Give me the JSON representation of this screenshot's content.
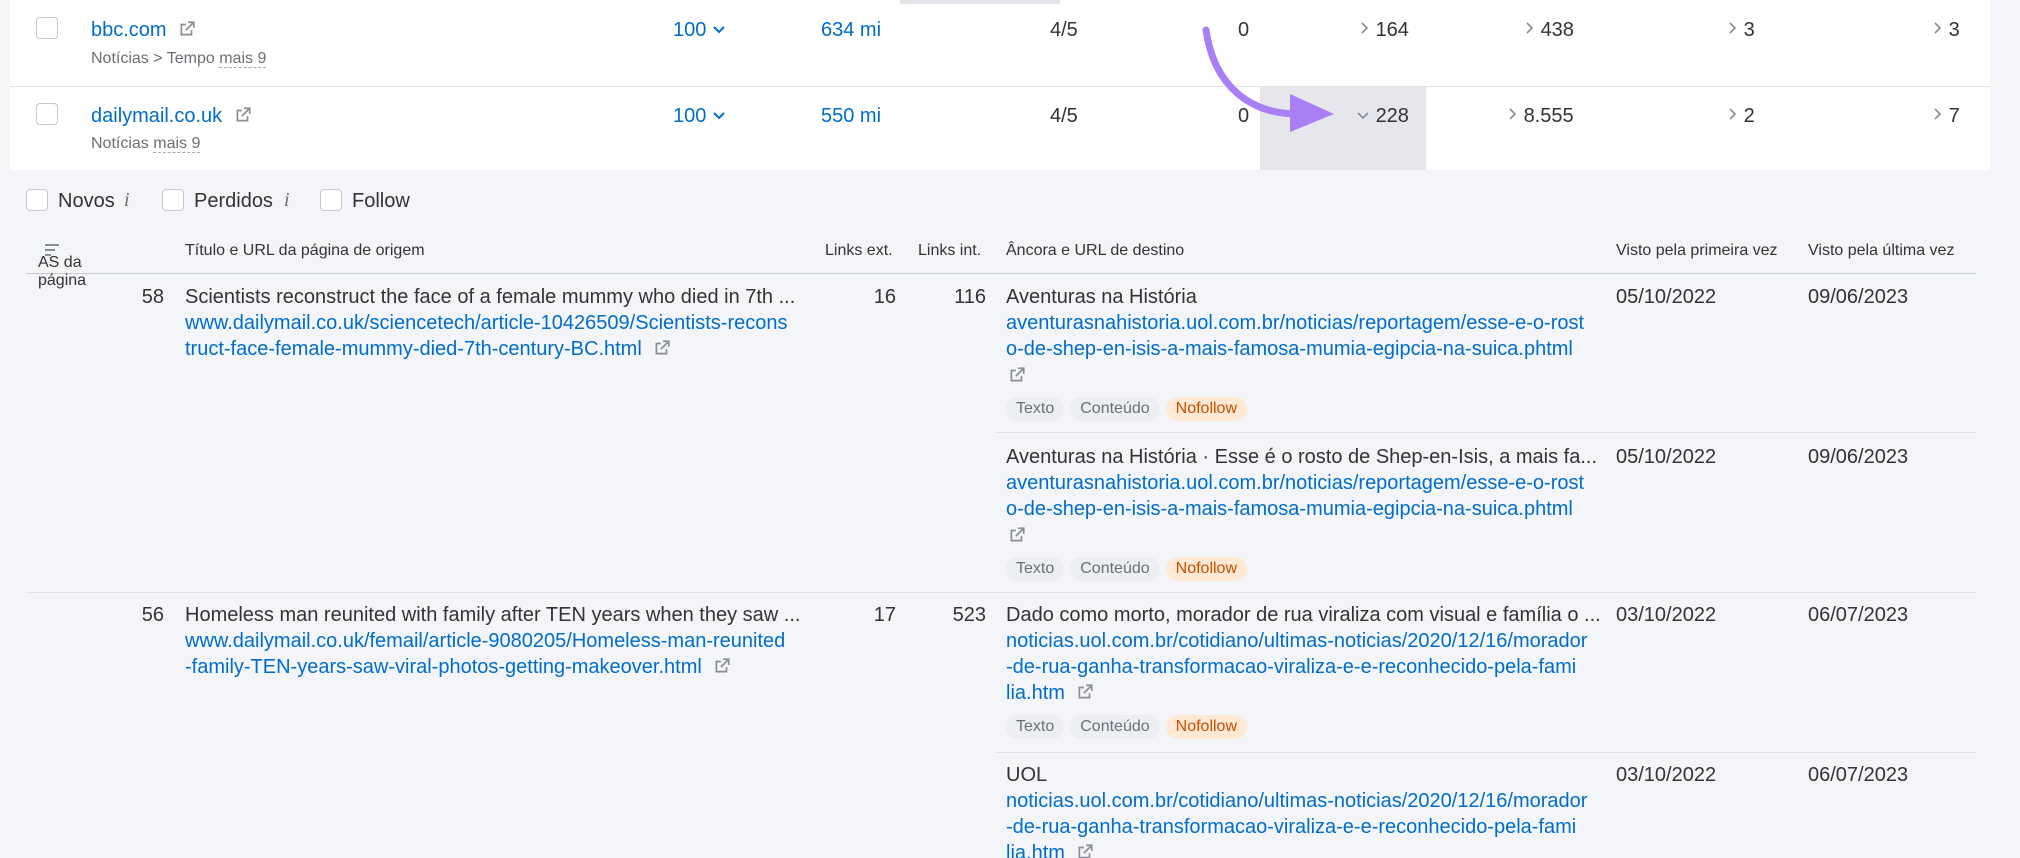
{
  "domains": [
    {
      "domain": "bbc.com",
      "category": "Notícias > Tempo",
      "more": "mais 9",
      "as": "100",
      "traffic": "634 mi",
      "ratio": "4/5",
      "zero": "0",
      "c1": "164",
      "c2": "438",
      "c3": "3",
      "c4": "3"
    },
    {
      "domain": "dailymail.co.uk",
      "category": "Notícias",
      "more": "mais 9",
      "as": "100",
      "traffic": "550 mi",
      "ratio": "4/5",
      "zero": "0",
      "c1": "228",
      "c2": "8.555",
      "c3": "2",
      "c4": "7"
    }
  ],
  "filters": {
    "new": "Novos",
    "lost": "Perdidos",
    "follow": "Follow"
  },
  "columns": {
    "as": "AS da página",
    "source": "Título e URL da página de origem",
    "ext": "Links ext.",
    "int": "Links int.",
    "anchor": "Âncora e URL de destino",
    "first": "Visto pela primeira vez",
    "last": "Visto pela última vez"
  },
  "tags": {
    "text": "Texto",
    "content": "Conteúdo",
    "nofollow": "Nofollow"
  },
  "backlinks": [
    {
      "as": "58",
      "title": "Scientists reconstruct the face of a female mummy who died in 7th ...",
      "url1": "www.dailymail.co.uk/sciencetech/article-10426509/Scientists-recons",
      "url2": "truct-face-female-mummy-died-7th-century-BC.html",
      "ext": "16",
      "int": "116",
      "anchors": [
        {
          "anchor": "Aventuras na História",
          "u1": "aventurasnahistoria.uol.com.br/noticias/reportagem/esse-e-o-rost",
          "u2": "o-de-shep-en-isis-a-mais-famosa-mumia-egipcia-na-suica.phtml",
          "u3": "",
          "first": "05/10/2022",
          "last": "09/06/2023"
        },
        {
          "anchor": "Aventuras na História · Esse é o rosto de Shep-en-Isis, a mais fa...",
          "u1": "aventurasnahistoria.uol.com.br/noticias/reportagem/esse-e-o-rost",
          "u2": "o-de-shep-en-isis-a-mais-famosa-mumia-egipcia-na-suica.phtml",
          "u3": "",
          "first": "05/10/2022",
          "last": "09/06/2023"
        }
      ]
    },
    {
      "as": "56",
      "title": "Homeless man reunited with family after TEN years when they saw ...",
      "url1": "www.dailymail.co.uk/femail/article-9080205/Homeless-man-reunited",
      "url2": "-family-TEN-years-saw-viral-photos-getting-makeover.html",
      "ext": "17",
      "int": "523",
      "anchors": [
        {
          "anchor": "Dado como morto, morador de rua viraliza com visual e família o ...",
          "u1": "noticias.uol.com.br/cotidiano/ultimas-noticias/2020/12/16/morador",
          "u2": "-de-rua-ganha-transformacao-viraliza-e-e-reconhecido-pela-fami",
          "u3": "lia.htm",
          "first": "03/10/2022",
          "last": "06/07/2023"
        },
        {
          "anchor": "UOL",
          "u1": "noticias.uol.com.br/cotidiano/ultimas-noticias/2020/12/16/morador",
          "u2": "-de-rua-ganha-transformacao-viraliza-e-e-reconhecido-pela-fami",
          "u3": "lia.htm",
          "first": "03/10/2022",
          "last": "06/07/2023"
        }
      ]
    }
  ],
  "colors": {
    "link": "#006dca",
    "accent_arrow": "#a97ff5",
    "nofollow": "#c84e00"
  }
}
